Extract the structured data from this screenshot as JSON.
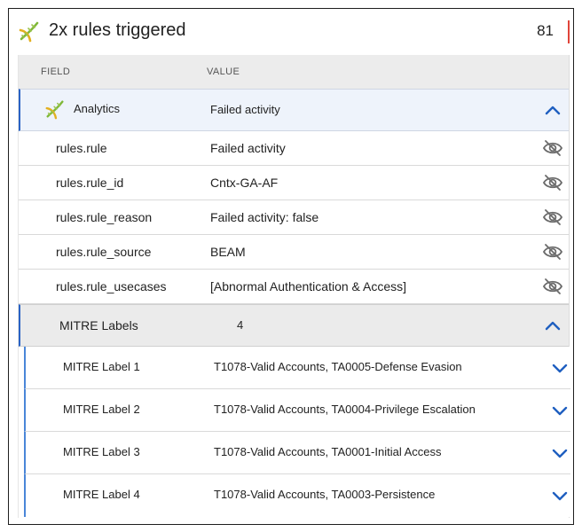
{
  "header": {
    "title": "2x rules triggered",
    "score": "81",
    "icon": "dna-icon",
    "accent_color": "#e0443a"
  },
  "table": {
    "columns": [
      "FIELD",
      "VALUE"
    ],
    "analytics_group": {
      "label": "Analytics",
      "value": "Failed activity",
      "icon": "dna-icon",
      "expanded": true
    },
    "rows": [
      {
        "field": "rules.rule",
        "value": "Failed activity"
      },
      {
        "field": "rules.rule_id",
        "value": "Cntx-GA-AF"
      },
      {
        "field": "rules.rule_reason",
        "value": "Failed activity: false"
      },
      {
        "field": "rules.rule_source",
        "value": "BEAM"
      },
      {
        "field": "rules.rule_usecases",
        "value": "[Abnormal Authentication & Access]"
      }
    ],
    "mitre_group": {
      "label": "MITRE Labels",
      "count": "4",
      "expanded": true
    },
    "mitre_rows": [
      {
        "field": "MITRE Label 1",
        "value": "T1078-Valid Accounts, TA0005-Defense Evasion"
      },
      {
        "field": "MITRE Label 2",
        "value": "T1078-Valid Accounts, TA0004-Privilege Escalation"
      },
      {
        "field": "MITRE Label 3",
        "value": "T1078-Valid Accounts, TA0001-Initial Access"
      },
      {
        "field": "MITRE Label 4",
        "value": "T1078-Valid Accounts, TA0003-Persistence"
      }
    ]
  },
  "colors": {
    "chevron": "#1f5fc0",
    "group_border": "#2a63c5",
    "eye_icon": "#6b6b6b"
  }
}
